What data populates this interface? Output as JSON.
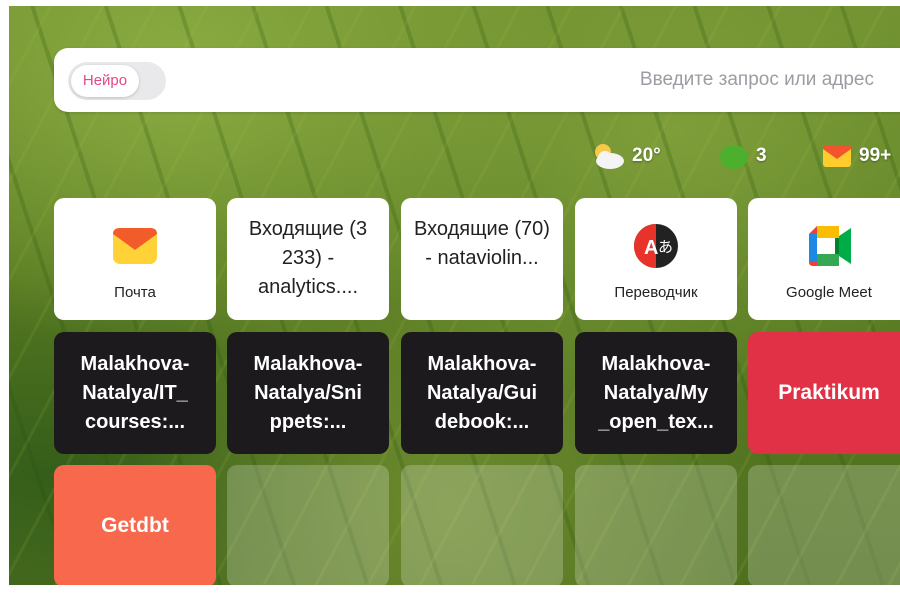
{
  "search": {
    "toggle_label": "Нейро",
    "placeholder": "Введите запрос или адрес"
  },
  "widgets": {
    "weather": "20°",
    "traffic": "3",
    "mail": "99+"
  },
  "tiles": [
    {
      "type": "icon",
      "label": "Почта",
      "icon": "yandex-mail-icon"
    },
    {
      "type": "text",
      "title": "Входящие (3 233) - analytics...."
    },
    {
      "type": "text",
      "title": "Входящие (70) - nataviolin..."
    },
    {
      "type": "icon",
      "label": "Переводчик",
      "icon": "translator-icon"
    },
    {
      "type": "icon",
      "label": "Google Meet",
      "icon": "google-meet-icon"
    },
    {
      "type": "dark",
      "title": "Malakhova-Natalya/IT_ courses:..."
    },
    {
      "type": "dark",
      "title": "Malakhova-Natalya/Sni ppets:..."
    },
    {
      "type": "dark",
      "title": "Malakhova-Natalya/Gui debook:..."
    },
    {
      "type": "dark",
      "title": "Malakhova-Natalya/My _open_tex..."
    },
    {
      "type": "solid",
      "title": "Praktikum",
      "color": "#e03146"
    },
    {
      "type": "solid",
      "title": "Getdbt",
      "color": "#f7684d"
    }
  ]
}
